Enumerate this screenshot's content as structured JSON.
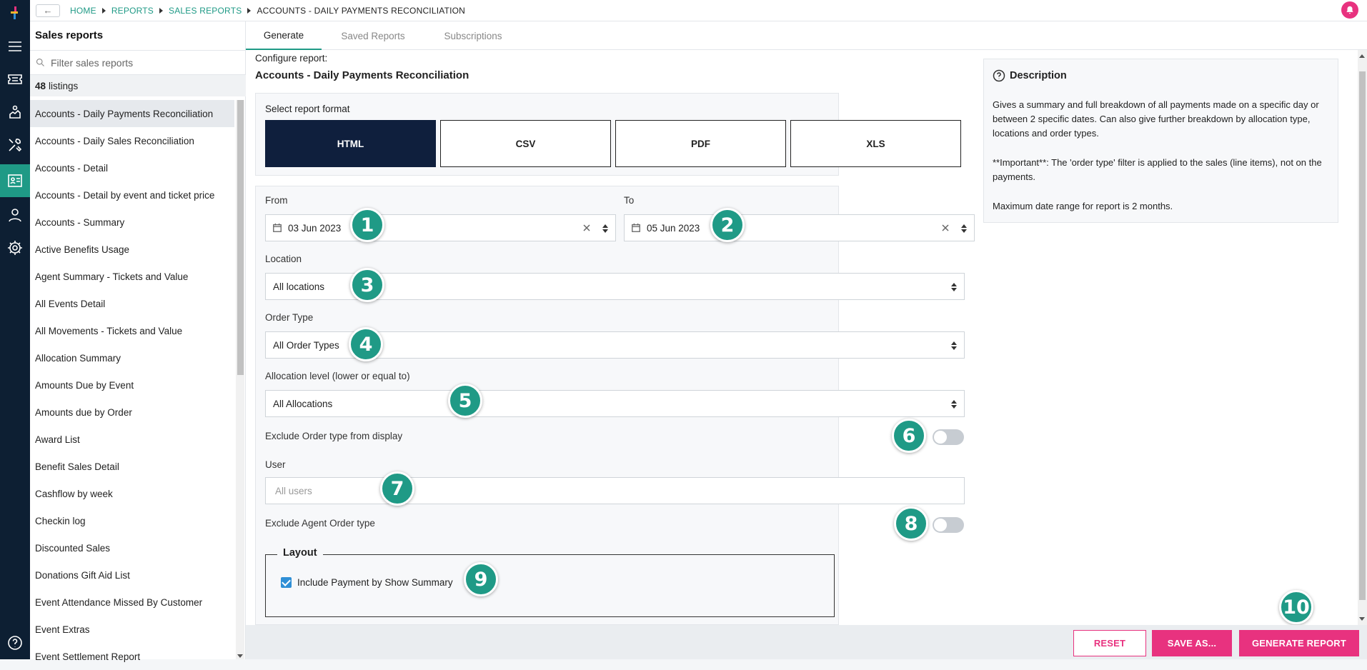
{
  "breadcrumb": {
    "back_icon": "arrow-left-icon",
    "items": [
      "HOME",
      "REPORTS",
      "SALES REPORTS",
      "ACCOUNTS - DAILY PAYMENTS RECONCILIATION"
    ]
  },
  "rail": {
    "icons": [
      "logo-icon",
      "menu-icon",
      "ticket-icon",
      "chart-icon",
      "tools-icon",
      "report-icon",
      "user-icon",
      "gear-icon",
      "help-icon"
    ],
    "active": "report-icon"
  },
  "sidebar": {
    "title": "Sales reports",
    "search_placeholder": "Filter sales reports",
    "count_number": "48",
    "count_label": "listings",
    "items": [
      "Accounts - Daily Payments Reconciliation",
      "Accounts - Daily Sales Reconciliation",
      "Accounts - Detail",
      "Accounts - Detail by event and ticket price",
      "Accounts - Summary",
      "Active Benefits Usage",
      "Agent Summary - Tickets and Value",
      "All Events Detail",
      "All Movements - Tickets and Value",
      "Allocation Summary",
      "Amounts Due by Event",
      "Amounts due by Order",
      "Award List",
      "Benefit Sales Detail",
      "Cashflow by week",
      "Checkin log",
      "Discounted Sales",
      "Donations Gift Aid List",
      "Event Attendance Missed By Customer",
      "Event Extras",
      "Event Settlement Report"
    ]
  },
  "tabs": [
    "Generate",
    "Saved Reports",
    "Subscriptions"
  ],
  "main": {
    "configure_label": "Configure report:",
    "report_name": "Accounts - Daily Payments Reconciliation",
    "format_label": "Select report format",
    "formats": [
      "HTML",
      "CSV",
      "PDF",
      "XLS"
    ],
    "selected_format": "HTML",
    "from_label": "From",
    "from_value": "03 Jun 2023",
    "to_label": "To",
    "to_value": "05 Jun 2023",
    "location_label": "Location",
    "location_value": "All locations",
    "order_type_label": "Order Type",
    "order_type_value": "All Order Types",
    "allocation_label": "Allocation level (lower or equal to)",
    "allocation_value": "All Allocations",
    "exclude_order_type_label": "Exclude Order type from display",
    "exclude_order_type_on": false,
    "user_label": "User",
    "user_placeholder": "All users",
    "exclude_agent_label": "Exclude Agent Order type",
    "exclude_agent_on": false,
    "layout_title": "Layout",
    "include_payment_label": "Include Payment by Show Summary",
    "include_payment_checked": true
  },
  "badges": [
    "1",
    "2",
    "3",
    "4",
    "5",
    "6",
    "7",
    "8",
    "9",
    "10"
  ],
  "description": {
    "title": "Description",
    "p1": "Gives a summary and full breakdown of all payments made on a specific day or between 2 specific dates. Can also give further breakdown by allocation type, locations and order types.",
    "p2": "**Important**: The 'order type' filter is applied to the sales (line items), not on the payments.",
    "p3": "Maximum date range for report is 2 months."
  },
  "footer": {
    "reset": "RESET",
    "save_as": "SAVE AS...",
    "generate": "GENERATE REPORT"
  },
  "colors": {
    "accent": "#1f9a86",
    "brand_pink": "#e8327f",
    "navy": "#0f1f3d",
    "rail": "#0d1f33"
  }
}
